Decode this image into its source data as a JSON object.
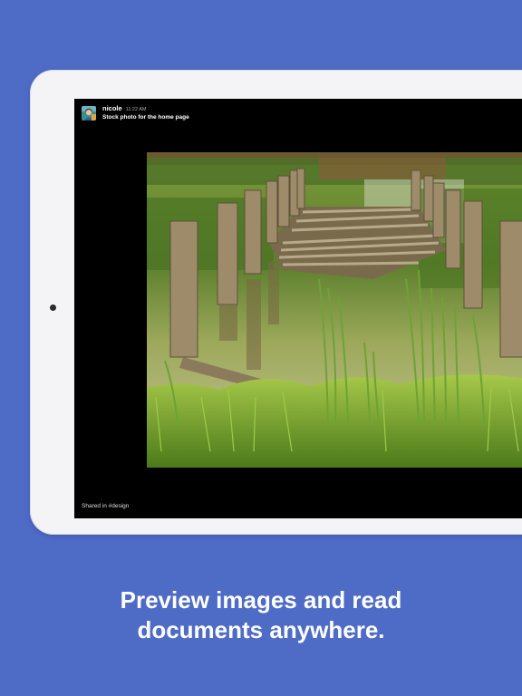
{
  "message": {
    "username": "nicole",
    "timestamp": "11:22 AM",
    "caption": "Stock photo for the home page"
  },
  "footer": {
    "shared_text": "Shared in #design"
  },
  "marketing": {
    "headline_line1": "Preview images and read",
    "headline_line2": "documents anywhere."
  },
  "colors": {
    "background": "#4e6bc6",
    "device_frame": "#f4f4f6",
    "screen": "#000000"
  },
  "icons": {
    "home_button": "home-button-dot",
    "avatar": "user-avatar"
  }
}
